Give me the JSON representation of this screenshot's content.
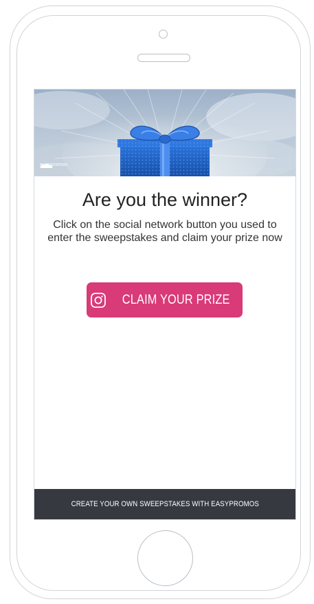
{
  "colors": {
    "button_bg": "#d93a78",
    "footer_bg": "#363940",
    "gift_blue": "#1e63c9",
    "ribbon_blue": "#3b7de0",
    "headline_text": "#222222"
  },
  "banner": {
    "image": "gift-box-banner",
    "brand_logo_text": "easypromos"
  },
  "main": {
    "headline": "Are you the winner?",
    "subtext": "Click on the social network button you used to enter the sweepstakes and claim your prize now",
    "claim_button": {
      "icon": "instagram-icon",
      "label": "CLAIM YOUR PRIZE"
    }
  },
  "footer": {
    "link_text": "CREATE YOUR OWN SWEEPSTAKES WITH EASYPROMOS"
  }
}
